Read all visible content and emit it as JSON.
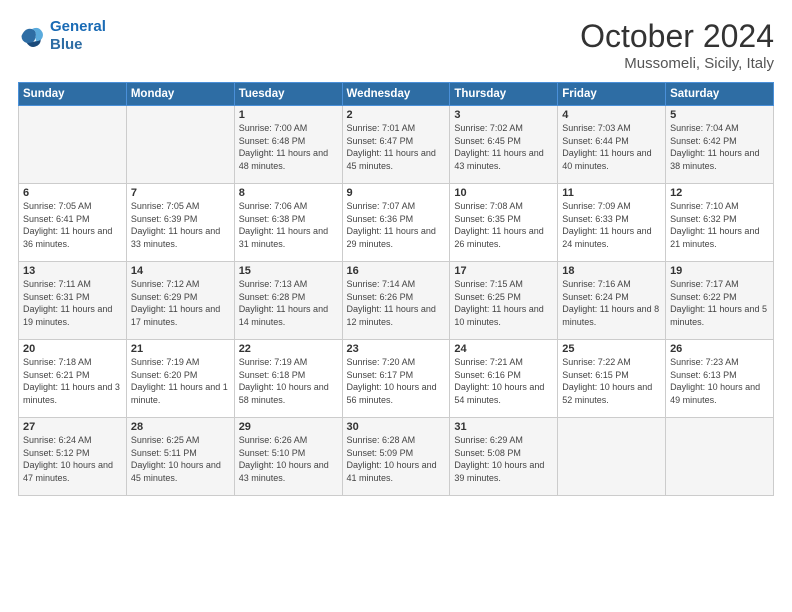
{
  "header": {
    "logo_line1": "General",
    "logo_line2": "Blue",
    "month": "October 2024",
    "location": "Mussomeli, Sicily, Italy"
  },
  "days_of_week": [
    "Sunday",
    "Monday",
    "Tuesday",
    "Wednesday",
    "Thursday",
    "Friday",
    "Saturday"
  ],
  "weeks": [
    [
      {
        "day": "",
        "info": ""
      },
      {
        "day": "",
        "info": ""
      },
      {
        "day": "1",
        "info": "Sunrise: 7:00 AM\nSunset: 6:48 PM\nDaylight: 11 hours and 48 minutes."
      },
      {
        "day": "2",
        "info": "Sunrise: 7:01 AM\nSunset: 6:47 PM\nDaylight: 11 hours and 45 minutes."
      },
      {
        "day": "3",
        "info": "Sunrise: 7:02 AM\nSunset: 6:45 PM\nDaylight: 11 hours and 43 minutes."
      },
      {
        "day": "4",
        "info": "Sunrise: 7:03 AM\nSunset: 6:44 PM\nDaylight: 11 hours and 40 minutes."
      },
      {
        "day": "5",
        "info": "Sunrise: 7:04 AM\nSunset: 6:42 PM\nDaylight: 11 hours and 38 minutes."
      }
    ],
    [
      {
        "day": "6",
        "info": "Sunrise: 7:05 AM\nSunset: 6:41 PM\nDaylight: 11 hours and 36 minutes."
      },
      {
        "day": "7",
        "info": "Sunrise: 7:05 AM\nSunset: 6:39 PM\nDaylight: 11 hours and 33 minutes."
      },
      {
        "day": "8",
        "info": "Sunrise: 7:06 AM\nSunset: 6:38 PM\nDaylight: 11 hours and 31 minutes."
      },
      {
        "day": "9",
        "info": "Sunrise: 7:07 AM\nSunset: 6:36 PM\nDaylight: 11 hours and 29 minutes."
      },
      {
        "day": "10",
        "info": "Sunrise: 7:08 AM\nSunset: 6:35 PM\nDaylight: 11 hours and 26 minutes."
      },
      {
        "day": "11",
        "info": "Sunrise: 7:09 AM\nSunset: 6:33 PM\nDaylight: 11 hours and 24 minutes."
      },
      {
        "day": "12",
        "info": "Sunrise: 7:10 AM\nSunset: 6:32 PM\nDaylight: 11 hours and 21 minutes."
      }
    ],
    [
      {
        "day": "13",
        "info": "Sunrise: 7:11 AM\nSunset: 6:31 PM\nDaylight: 11 hours and 19 minutes."
      },
      {
        "day": "14",
        "info": "Sunrise: 7:12 AM\nSunset: 6:29 PM\nDaylight: 11 hours and 17 minutes."
      },
      {
        "day": "15",
        "info": "Sunrise: 7:13 AM\nSunset: 6:28 PM\nDaylight: 11 hours and 14 minutes."
      },
      {
        "day": "16",
        "info": "Sunrise: 7:14 AM\nSunset: 6:26 PM\nDaylight: 11 hours and 12 minutes."
      },
      {
        "day": "17",
        "info": "Sunrise: 7:15 AM\nSunset: 6:25 PM\nDaylight: 11 hours and 10 minutes."
      },
      {
        "day": "18",
        "info": "Sunrise: 7:16 AM\nSunset: 6:24 PM\nDaylight: 11 hours and 8 minutes."
      },
      {
        "day": "19",
        "info": "Sunrise: 7:17 AM\nSunset: 6:22 PM\nDaylight: 11 hours and 5 minutes."
      }
    ],
    [
      {
        "day": "20",
        "info": "Sunrise: 7:18 AM\nSunset: 6:21 PM\nDaylight: 11 hours and 3 minutes."
      },
      {
        "day": "21",
        "info": "Sunrise: 7:19 AM\nSunset: 6:20 PM\nDaylight: 11 hours and 1 minute."
      },
      {
        "day": "22",
        "info": "Sunrise: 7:19 AM\nSunset: 6:18 PM\nDaylight: 10 hours and 58 minutes."
      },
      {
        "day": "23",
        "info": "Sunrise: 7:20 AM\nSunset: 6:17 PM\nDaylight: 10 hours and 56 minutes."
      },
      {
        "day": "24",
        "info": "Sunrise: 7:21 AM\nSunset: 6:16 PM\nDaylight: 10 hours and 54 minutes."
      },
      {
        "day": "25",
        "info": "Sunrise: 7:22 AM\nSunset: 6:15 PM\nDaylight: 10 hours and 52 minutes."
      },
      {
        "day": "26",
        "info": "Sunrise: 7:23 AM\nSunset: 6:13 PM\nDaylight: 10 hours and 49 minutes."
      }
    ],
    [
      {
        "day": "27",
        "info": "Sunrise: 6:24 AM\nSunset: 5:12 PM\nDaylight: 10 hours and 47 minutes."
      },
      {
        "day": "28",
        "info": "Sunrise: 6:25 AM\nSunset: 5:11 PM\nDaylight: 10 hours and 45 minutes."
      },
      {
        "day": "29",
        "info": "Sunrise: 6:26 AM\nSunset: 5:10 PM\nDaylight: 10 hours and 43 minutes."
      },
      {
        "day": "30",
        "info": "Sunrise: 6:28 AM\nSunset: 5:09 PM\nDaylight: 10 hours and 41 minutes."
      },
      {
        "day": "31",
        "info": "Sunrise: 6:29 AM\nSunset: 5:08 PM\nDaylight: 10 hours and 39 minutes."
      },
      {
        "day": "",
        "info": ""
      },
      {
        "day": "",
        "info": ""
      }
    ]
  ]
}
